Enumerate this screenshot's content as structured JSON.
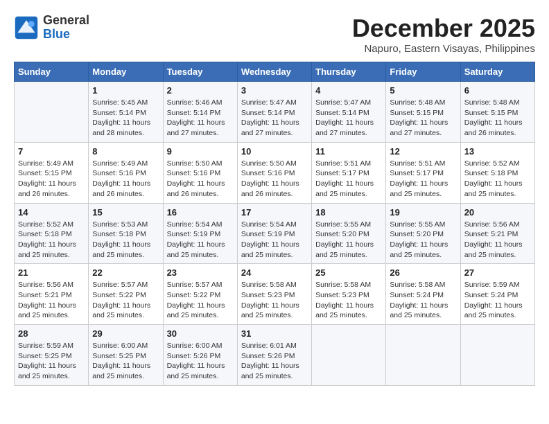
{
  "header": {
    "logo_line1": "General",
    "logo_line2": "Blue",
    "title": "December 2025",
    "subtitle": "Napuro, Eastern Visayas, Philippines"
  },
  "columns": [
    "Sunday",
    "Monday",
    "Tuesday",
    "Wednesday",
    "Thursday",
    "Friday",
    "Saturday"
  ],
  "weeks": [
    [
      {
        "day": "",
        "detail": ""
      },
      {
        "day": "1",
        "detail": "Sunrise: 5:45 AM\nSunset: 5:14 PM\nDaylight: 11 hours\nand 28 minutes."
      },
      {
        "day": "2",
        "detail": "Sunrise: 5:46 AM\nSunset: 5:14 PM\nDaylight: 11 hours\nand 27 minutes."
      },
      {
        "day": "3",
        "detail": "Sunrise: 5:47 AM\nSunset: 5:14 PM\nDaylight: 11 hours\nand 27 minutes."
      },
      {
        "day": "4",
        "detail": "Sunrise: 5:47 AM\nSunset: 5:14 PM\nDaylight: 11 hours\nand 27 minutes."
      },
      {
        "day": "5",
        "detail": "Sunrise: 5:48 AM\nSunset: 5:15 PM\nDaylight: 11 hours\nand 27 minutes."
      },
      {
        "day": "6",
        "detail": "Sunrise: 5:48 AM\nSunset: 5:15 PM\nDaylight: 11 hours\nand 26 minutes."
      }
    ],
    [
      {
        "day": "7",
        "detail": "Sunrise: 5:49 AM\nSunset: 5:15 PM\nDaylight: 11 hours\nand 26 minutes."
      },
      {
        "day": "8",
        "detail": "Sunrise: 5:49 AM\nSunset: 5:16 PM\nDaylight: 11 hours\nand 26 minutes."
      },
      {
        "day": "9",
        "detail": "Sunrise: 5:50 AM\nSunset: 5:16 PM\nDaylight: 11 hours\nand 26 minutes."
      },
      {
        "day": "10",
        "detail": "Sunrise: 5:50 AM\nSunset: 5:16 PM\nDaylight: 11 hours\nand 26 minutes."
      },
      {
        "day": "11",
        "detail": "Sunrise: 5:51 AM\nSunset: 5:17 PM\nDaylight: 11 hours\nand 25 minutes."
      },
      {
        "day": "12",
        "detail": "Sunrise: 5:51 AM\nSunset: 5:17 PM\nDaylight: 11 hours\nand 25 minutes."
      },
      {
        "day": "13",
        "detail": "Sunrise: 5:52 AM\nSunset: 5:18 PM\nDaylight: 11 hours\nand 25 minutes."
      }
    ],
    [
      {
        "day": "14",
        "detail": "Sunrise: 5:52 AM\nSunset: 5:18 PM\nDaylight: 11 hours\nand 25 minutes."
      },
      {
        "day": "15",
        "detail": "Sunrise: 5:53 AM\nSunset: 5:18 PM\nDaylight: 11 hours\nand 25 minutes."
      },
      {
        "day": "16",
        "detail": "Sunrise: 5:54 AM\nSunset: 5:19 PM\nDaylight: 11 hours\nand 25 minutes."
      },
      {
        "day": "17",
        "detail": "Sunrise: 5:54 AM\nSunset: 5:19 PM\nDaylight: 11 hours\nand 25 minutes."
      },
      {
        "day": "18",
        "detail": "Sunrise: 5:55 AM\nSunset: 5:20 PM\nDaylight: 11 hours\nand 25 minutes."
      },
      {
        "day": "19",
        "detail": "Sunrise: 5:55 AM\nSunset: 5:20 PM\nDaylight: 11 hours\nand 25 minutes."
      },
      {
        "day": "20",
        "detail": "Sunrise: 5:56 AM\nSunset: 5:21 PM\nDaylight: 11 hours\nand 25 minutes."
      }
    ],
    [
      {
        "day": "21",
        "detail": "Sunrise: 5:56 AM\nSunset: 5:21 PM\nDaylight: 11 hours\nand 25 minutes."
      },
      {
        "day": "22",
        "detail": "Sunrise: 5:57 AM\nSunset: 5:22 PM\nDaylight: 11 hours\nand 25 minutes."
      },
      {
        "day": "23",
        "detail": "Sunrise: 5:57 AM\nSunset: 5:22 PM\nDaylight: 11 hours\nand 25 minutes."
      },
      {
        "day": "24",
        "detail": "Sunrise: 5:58 AM\nSunset: 5:23 PM\nDaylight: 11 hours\nand 25 minutes."
      },
      {
        "day": "25",
        "detail": "Sunrise: 5:58 AM\nSunset: 5:23 PM\nDaylight: 11 hours\nand 25 minutes."
      },
      {
        "day": "26",
        "detail": "Sunrise: 5:58 AM\nSunset: 5:24 PM\nDaylight: 11 hours\nand 25 minutes."
      },
      {
        "day": "27",
        "detail": "Sunrise: 5:59 AM\nSunset: 5:24 PM\nDaylight: 11 hours\nand 25 minutes."
      }
    ],
    [
      {
        "day": "28",
        "detail": "Sunrise: 5:59 AM\nSunset: 5:25 PM\nDaylight: 11 hours\nand 25 minutes."
      },
      {
        "day": "29",
        "detail": "Sunrise: 6:00 AM\nSunset: 5:25 PM\nDaylight: 11 hours\nand 25 minutes."
      },
      {
        "day": "30",
        "detail": "Sunrise: 6:00 AM\nSunset: 5:26 PM\nDaylight: 11 hours\nand 25 minutes."
      },
      {
        "day": "31",
        "detail": "Sunrise: 6:01 AM\nSunset: 5:26 PM\nDaylight: 11 hours\nand 25 minutes."
      },
      {
        "day": "",
        "detail": ""
      },
      {
        "day": "",
        "detail": ""
      },
      {
        "day": "",
        "detail": ""
      }
    ]
  ]
}
